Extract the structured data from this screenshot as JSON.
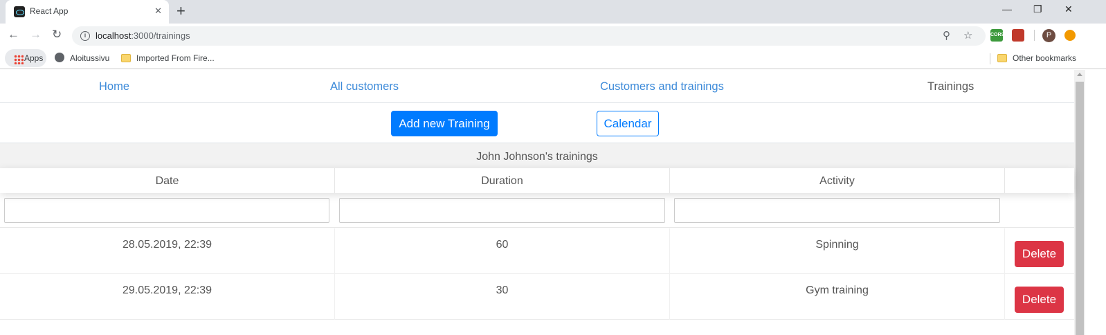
{
  "browser": {
    "tab_title": "React App",
    "tab_close": "✕",
    "new_tab": "+",
    "url_host": "localhost",
    "url_path": ":3000/trainings",
    "window_controls": [
      "—",
      "❐",
      "✕"
    ],
    "bookmarks": {
      "apps": "Apps",
      "items": [
        "Aloitussivu",
        "Imported From Fire..."
      ],
      "other": "Other bookmarks"
    },
    "extensions": {
      "cors": "CORS",
      "profile_initial": "P"
    },
    "colors": {
      "tabstrip": "#dee1e6",
      "omnibox": "#f1f3f4"
    }
  },
  "nav": {
    "links": [
      "Home",
      "All customers",
      "Customers and trainings",
      "Trainings"
    ],
    "active": "Trainings"
  },
  "actions": {
    "add_label": "Add new Training",
    "calendar_label": "Calendar"
  },
  "table": {
    "caption": "John Johnson's trainings",
    "headers": [
      "Date",
      "Duration",
      "Activity",
      ""
    ],
    "filters": [
      "",
      "",
      ""
    ],
    "rows": [
      {
        "date": "28.05.2019, 22:39",
        "duration": "60",
        "activity": "Spinning",
        "action": "Delete"
      },
      {
        "date": "29.05.2019, 22:39",
        "duration": "30",
        "activity": "Gym training",
        "action": "Delete"
      }
    ]
  },
  "colors": {
    "primary": "#007bff",
    "danger": "#dc3545",
    "link": "#3c8ad9"
  }
}
